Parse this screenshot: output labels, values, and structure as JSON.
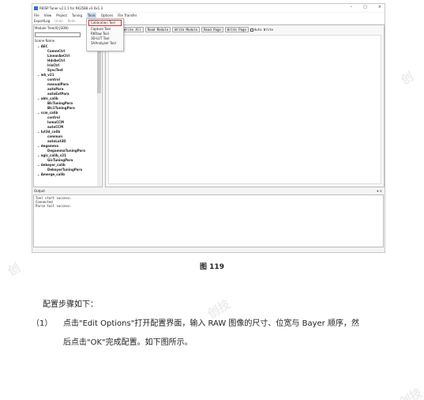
{
  "window": {
    "title": "RKISP Tuner v2.1.1 for RK3588 v3.0x1.3",
    "controls": [
      "–",
      "□",
      "×"
    ]
  },
  "menubar": [
    "File",
    "View",
    "Project",
    "Tuning",
    "Tools",
    "Options",
    "File Transfer"
  ],
  "toolbar": [
    "ExportLog",
    "Undo",
    "Redo"
  ],
  "tools_menu": [
    "Calibration Tool",
    "Capture Tool",
    "RKRaw Tool",
    "3D-LUT Tool",
    "3AAnalyzer Tool"
  ],
  "left_panel": {
    "module_label": "Module Tree(IQ JSON)",
    "scene_header": "Scene Name",
    "items": [
      {
        "label": "AEC",
        "level": 1
      },
      {
        "label": "CommCtrl",
        "level": 2
      },
      {
        "label": "LinearAeCtrl",
        "level": 2
      },
      {
        "label": "HdrAeCtrl",
        "level": 2
      },
      {
        "label": "IrisCtrl",
        "level": 2
      },
      {
        "label": "SyncTest",
        "level": 2
      },
      {
        "label": "wb_v21",
        "level": 1
      },
      {
        "label": "control",
        "level": 2
      },
      {
        "label": "manualPara",
        "level": 2
      },
      {
        "label": "autoPara",
        "level": 2
      },
      {
        "label": "autoExtPara",
        "level": 2
      },
      {
        "label": "ablc_calib",
        "level": 1
      },
      {
        "label": "BlcTuningPara",
        "level": 2
      },
      {
        "label": "Blc1TuningPara",
        "level": 2
      },
      {
        "label": "ccm_calib",
        "level": 1
      },
      {
        "label": "control",
        "level": 2
      },
      {
        "label": "lumaCCM",
        "level": 2
      },
      {
        "label": "autoCCM",
        "level": 2
      },
      {
        "label": "lut3d_calib",
        "level": 1
      },
      {
        "label": "common",
        "level": 2
      },
      {
        "label": "autoLut3D",
        "level": 2
      },
      {
        "label": "degamma",
        "level": 1
      },
      {
        "label": "DegammaTuningPara",
        "level": 2
      },
      {
        "label": "agic_calib_v21",
        "level": 1
      },
      {
        "label": "GicTuningPara",
        "level": 2
      },
      {
        "label": "debayer_calib",
        "level": 1
      },
      {
        "label": "DebayerTuningPara",
        "level": 2
      },
      {
        "label": "Amerge_calib",
        "level": 1
      }
    ]
  },
  "right_panel": {
    "buttons": [
      "Write All",
      "Read Module",
      "Write Module",
      "Read Page",
      "Write Page"
    ],
    "auto_write_label": "Auto Write"
  },
  "output": {
    "title": "Output",
    "ctrl": "▾ ×",
    "lines": [
      "Tool start success.",
      "Connected",
      "Parse tail success."
    ]
  },
  "watermarks": [
    "创技",
    "创",
    "创技",
    "创",
    "创技",
    "创技"
  ],
  "document": {
    "caption": "图 119",
    "p1": "配置步骤如下：",
    "p2_num": "（1）",
    "p2_text": "点击\"Edit Options\"打开配置界面，输入 RAW 图像的尺寸、位宽与 Bayer 顺序，然",
    "p3": "后点击\"OK\"完成配置。如下图所示。"
  }
}
